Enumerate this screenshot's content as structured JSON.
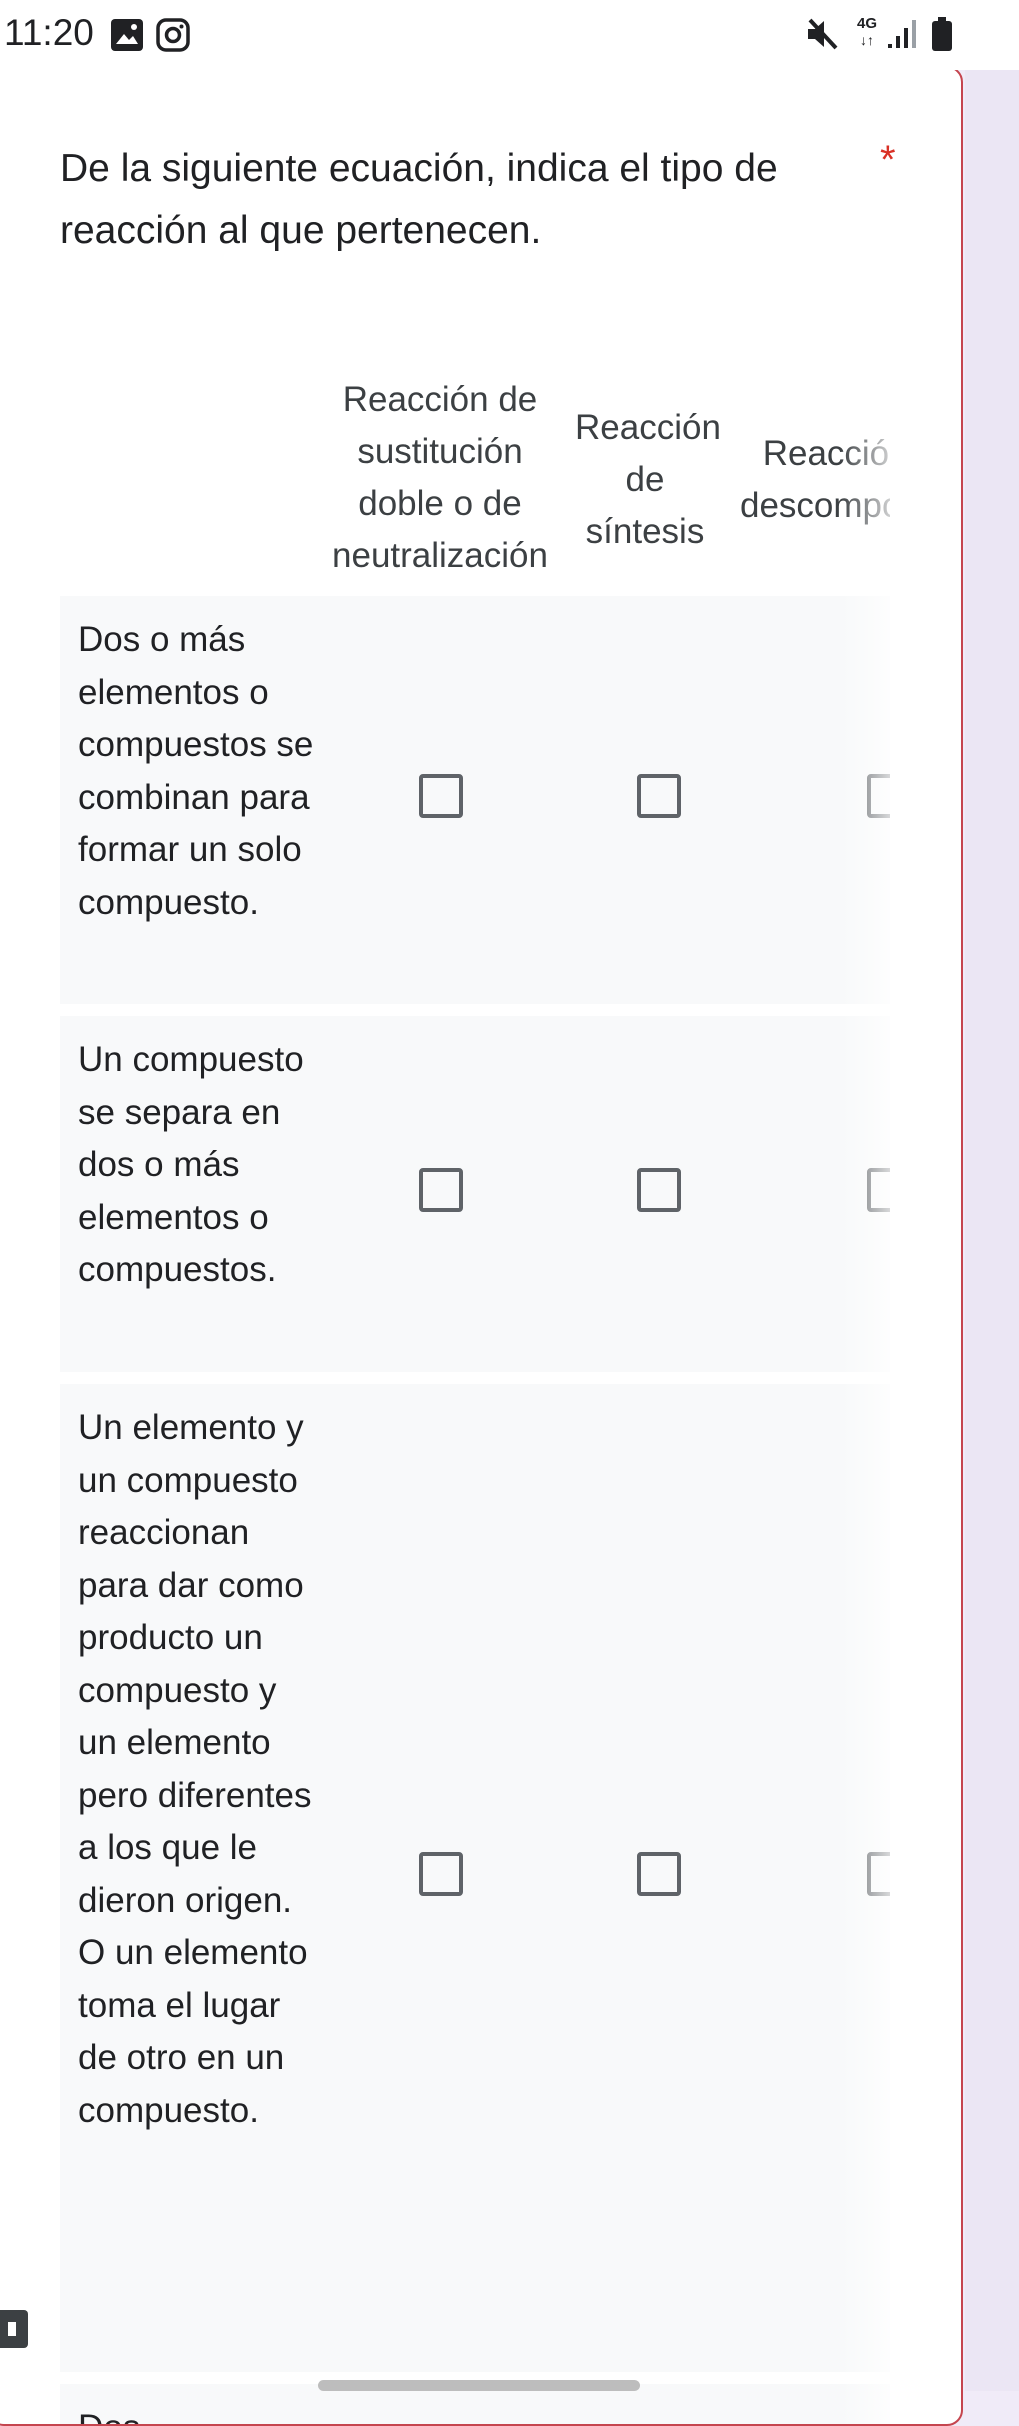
{
  "status_bar": {
    "time": "11:20",
    "network_label": "4G",
    "icons": [
      "image-icon",
      "instagram-icon",
      "mute-icon",
      "network-4g-icon",
      "signal-icon",
      "battery-icon"
    ]
  },
  "question": {
    "text": "De la siguiente ecuación, indica el tipo de reacción al que pertenecen.",
    "required_mark": "*"
  },
  "grid": {
    "columns": [
      "Reacción de sustitución doble o de neutralización",
      "Reacción de síntesis",
      "Reacción de descomposición"
    ],
    "rows": [
      {
        "label": "Dos o más elementos o compuestos se combinan para formar un solo compuesto.",
        "checked": [
          false,
          false,
          false
        ]
      },
      {
        "label": "Un compuesto se separa en dos o más elementos o compuestos.",
        "checked": [
          false,
          false,
          false
        ]
      },
      {
        "label": "Un elemento y un compuesto reaccionan para dar como producto un compuesto y un elemento pero diferentes a los que le dieron origen. O  un elemento toma el lugar de otro en un compuesto.",
        "checked": [
          false,
          false,
          false
        ]
      },
      {
        "label": "Dos",
        "checked": [
          false,
          false,
          false
        ]
      }
    ]
  },
  "colors": {
    "required": "#d93025",
    "card_border": "#c5454f",
    "row_background": "#f8f9fa",
    "page_background": "#f0ebf8"
  }
}
